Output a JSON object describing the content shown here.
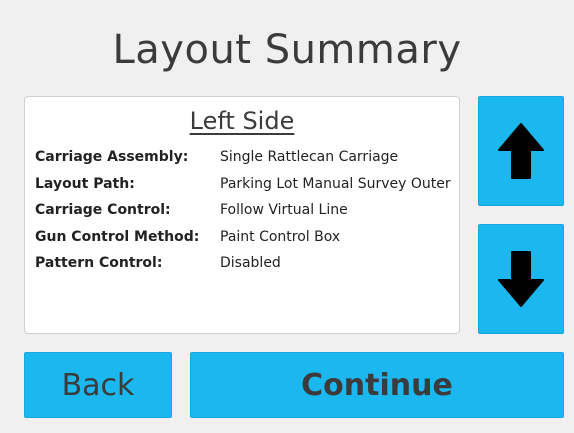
{
  "title": "Layout Summary",
  "panel": {
    "heading": "Left Side",
    "rows": [
      {
        "label": "Carriage Assembly:",
        "value": "Single Rattlecan Carriage"
      },
      {
        "label": "Layout Path:",
        "value": "Parking Lot Manual Survey Outer"
      },
      {
        "label": "Carriage Control:",
        "value": "Follow Virtual Line"
      },
      {
        "label": "Gun Control Method:",
        "value": "Paint Control Box"
      },
      {
        "label": "Pattern Control:",
        "value": "Disabled"
      }
    ]
  },
  "buttons": {
    "scroll_up_icon": "arrow-up-icon",
    "scroll_down_icon": "arrow-down-icon",
    "back": "Back",
    "continue": "Continue"
  },
  "colors": {
    "background": "#f0f0f0",
    "button": "#1bb8f0",
    "text": "#3b3b3b"
  }
}
